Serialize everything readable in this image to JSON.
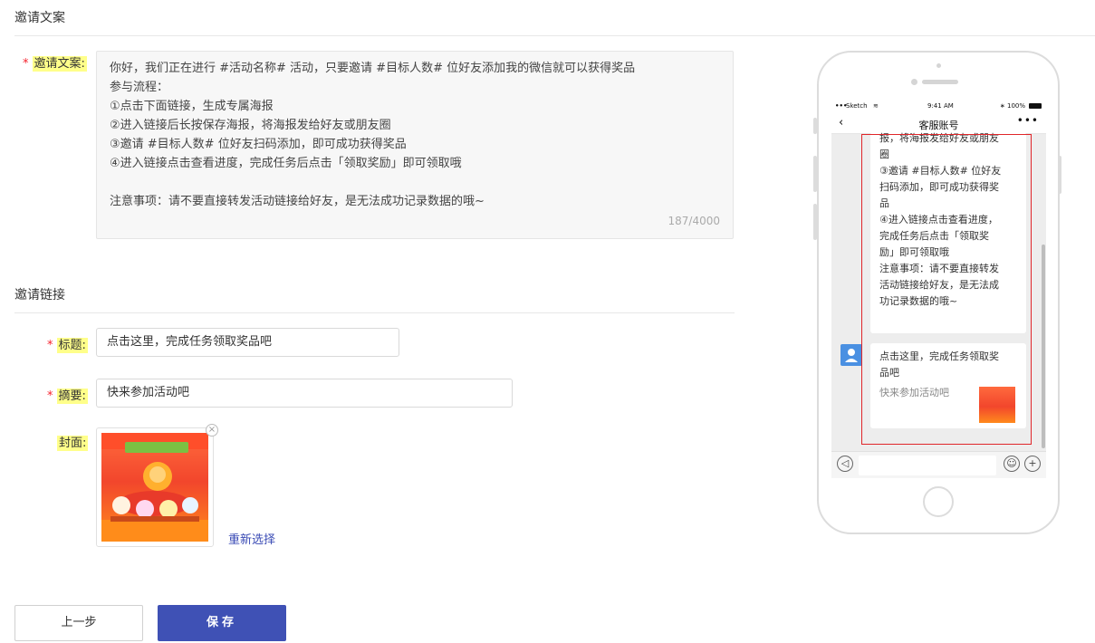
{
  "section1": {
    "title": "邀请文案"
  },
  "copy": {
    "label": "邀请文案:",
    "lines": [
      "你好，我们正在进行 #活动名称# 活动，只要邀请 #目标人数# 位好友添加我的微信就可以获得奖品",
      "参与流程：",
      "①点击下面链接，生成专属海报",
      "②进入链接后长按保存海报，将海报发给好友或朋友圈",
      "③邀请 #目标人数# 位好友扫码添加，即可成功获得奖品",
      "④进入链接点击查看进度，完成任务后点击「领取奖励」即可领取哦",
      "",
      "注意事项：请不要直接转发活动链接给好友，是无法成功记录数据的哦~"
    ],
    "counter": "187/4000"
  },
  "section2": {
    "title": "邀请链接"
  },
  "form": {
    "title_label": "标题:",
    "title_value": "点击这里，完成任务领取奖品吧",
    "summary_label": "摘要:",
    "summary_value": "快来参加活动吧",
    "cover_label": "封面:",
    "cover_close": "×",
    "reselect": "重新选择"
  },
  "buttons": {
    "prev": "上一步",
    "save": "保存"
  },
  "phone": {
    "carrier": "Sketch",
    "time": "9:41 AM",
    "battery": "100%",
    "nav_title": "客服账号",
    "nav_back": "‹",
    "nav_more": "•••",
    "bubble1_lines": [
      "报，将海报发给好友或朋友",
      "圈",
      "③邀请 #目标人数# 位好友",
      "扫码添加，即可成功获得奖",
      "品",
      "④进入链接点击查看进度，",
      "完成任务后点击「领取奖",
      "励」即可领取哦",
      "",
      "注意事项：请不要直接转发",
      "活动链接给好友，是无法成",
      "功记录数据的哦~"
    ],
    "card_title_lines": [
      "点击这里，完成任务领取奖",
      "品吧"
    ],
    "card_desc": "快来参加活动吧"
  },
  "colors": {
    "primary": "#3f51b5",
    "required": "#f5222d",
    "highlight": "#ffff8a",
    "preview_border": "#e0262a"
  }
}
